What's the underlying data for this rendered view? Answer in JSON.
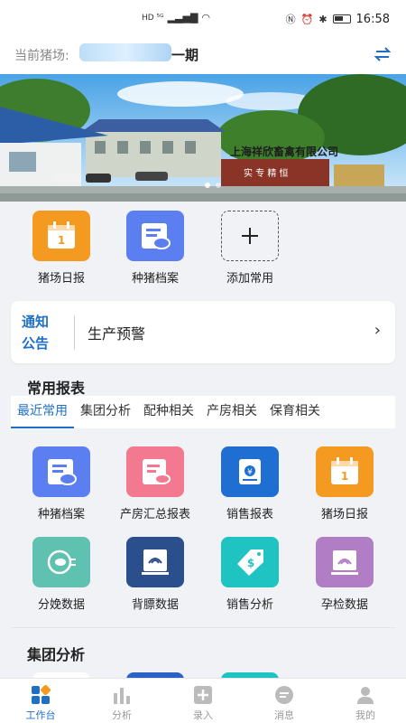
{
  "statusbar": {
    "net_left": "HD ⁵ᴳ",
    "time": "16:58"
  },
  "farm": {
    "label": "当前猪场:",
    "name": "一期"
  },
  "quick": [
    {
      "label": "猪场日报",
      "icon": "calendar-icon",
      "color": "#f59a20"
    },
    {
      "label": "种猪档案",
      "icon": "breeding-pig-file-icon",
      "color": "#5b7ff0"
    },
    {
      "label": "添加常用",
      "icon": "plus-icon",
      "color": "#555555"
    }
  ],
  "notice": {
    "tag_line1": "通知",
    "tag_line2": "公告",
    "text": "生产预警",
    "arrow": "›"
  },
  "reports": {
    "title": "常用报表",
    "tabs": [
      "最近常用",
      "集团分析",
      "配种相关",
      "产房相关",
      "保育相关"
    ],
    "items": [
      {
        "label": "种猪档案",
        "icon": "breeding-pig-file-icon",
        "color": "#5b7ff0"
      },
      {
        "label": "产房汇总报表",
        "icon": "farrowing-summary-icon",
        "color": "#f2798f"
      },
      {
        "label": "销售报表",
        "icon": "sales-report-icon",
        "color": "#1e6fd1"
      },
      {
        "label": "猪场日报",
        "icon": "calendar-icon",
        "color": "#f59a20"
      },
      {
        "label": "分娩数据",
        "icon": "farrowing-data-icon",
        "color": "#5fc1b0"
      },
      {
        "label": "背膘数据",
        "icon": "backfat-ultrasound-icon",
        "color": "#2b4f8c"
      },
      {
        "label": "销售分析",
        "icon": "price-tag-icon",
        "color": "#1fc4c2"
      },
      {
        "label": "孕检数据",
        "icon": "pregnancy-check-icon",
        "color": "#b17ec6"
      }
    ]
  },
  "group": {
    "title": "集团分析"
  },
  "tabbar": [
    {
      "label": "工作台",
      "icon": "workbench-icon",
      "active": true
    },
    {
      "label": "分析",
      "icon": "bar-chart-icon",
      "active": false
    },
    {
      "label": "录入",
      "icon": "plus-box-icon",
      "active": false
    },
    {
      "label": "消息",
      "icon": "message-icon",
      "active": false
    },
    {
      "label": "我的",
      "icon": "user-icon",
      "active": false
    }
  ],
  "colors": {
    "accent": "#1f6fc5",
    "background": "#f0f2f5"
  },
  "banner": {
    "sign_text": "上海祥欣畜禽有限公司",
    "wall_text": "实 专 精 恒"
  }
}
